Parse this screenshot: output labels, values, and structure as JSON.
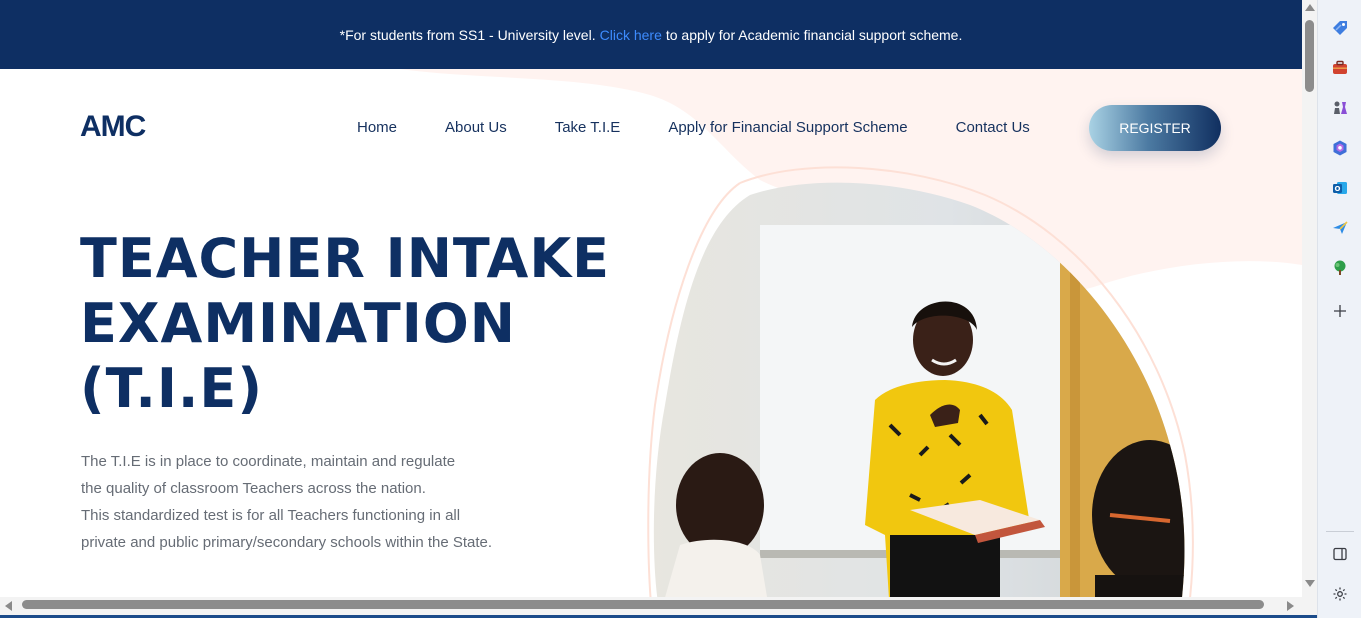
{
  "announcement": {
    "prefix": "*For students from SS1 - University level.",
    "link": "Click here",
    "suffix": "to apply for Academic financial support scheme."
  },
  "logo": "AMC",
  "nav": {
    "items": [
      "Home",
      "About Us",
      "Take T.I.E",
      "Apply for Financial Support Scheme",
      "Contact Us"
    ],
    "register": "REGISTER"
  },
  "hero": {
    "title_lines": [
      "TEACHER INTAKE",
      "EXAMINATION",
      "(T.I.E)"
    ],
    "description_lines": [
      "The T.I.E is in place to coordinate, maintain and regulate",
      "the quality of classroom Teachers across the nation.",
      "This standardized test is for all Teachers functioning in all",
      "private and public primary/secondary schools within the State."
    ]
  },
  "colors": {
    "navy": "#0e2f63",
    "link_blue": "#3d8bfd",
    "text_grey": "#666c75",
    "blob_pink": "#fff3f0"
  },
  "sidebar_icons": [
    "tag-icon",
    "briefcase-icon",
    "chess-icon",
    "copilot-icon",
    "outlook-icon",
    "send-icon",
    "tree-icon",
    "plus-icon",
    "split-screen-icon",
    "settings-icon"
  ]
}
